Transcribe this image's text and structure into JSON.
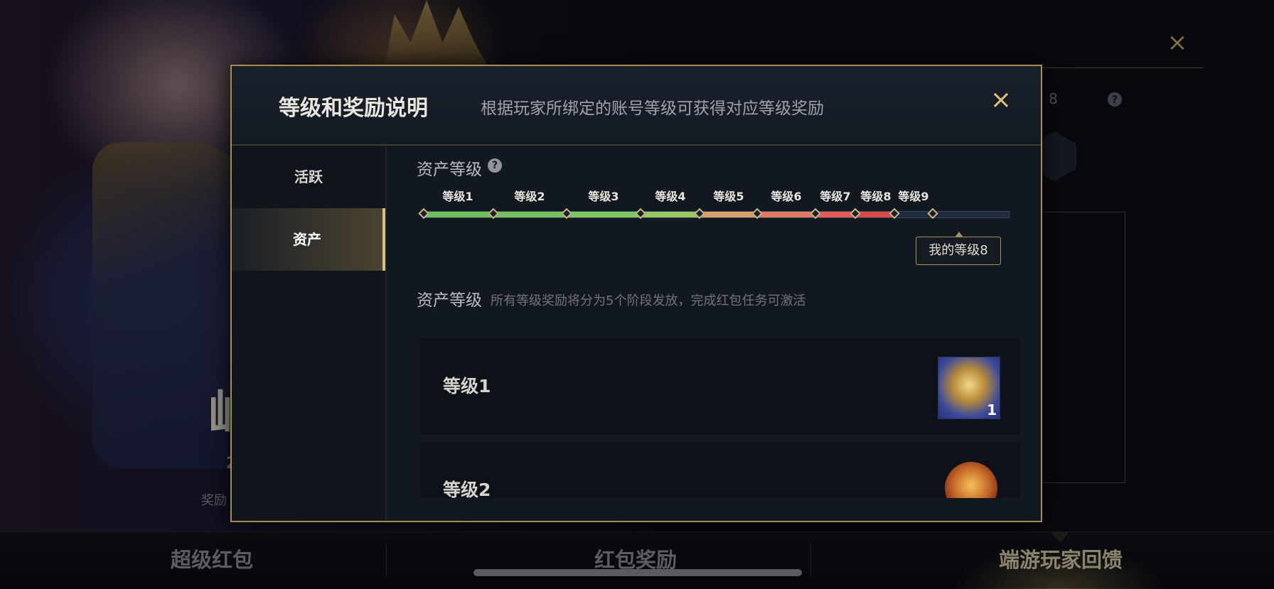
{
  "background": {
    "glyph": "屾",
    "small_text": "奖励",
    "small_two": "2",
    "level_text": ": 8",
    "help_icon": "?",
    "close_icon": "×"
  },
  "bottom_nav": {
    "tabs": [
      "超级红包",
      "红包奖励",
      "端游玩家回馈"
    ],
    "active_index": 2
  },
  "modal": {
    "title": "等级和奖励说明",
    "subtitle": "根据玩家所绑定的账号等级可获得对应等级奖励",
    "close_icon": "×",
    "sidebar": [
      "活跃",
      "资产"
    ],
    "active_sidebar_index": 1,
    "asset_level_title": "资产等级",
    "help_icon": "?",
    "track": {
      "labels": [
        "等级1",
        "等级2",
        "等级3",
        "等级4",
        "等级5",
        "等级6",
        "等级7",
        "等级8",
        "等级9"
      ],
      "segment_colors": [
        "#6fbf5a",
        "#73c25c",
        "#7ec75f",
        "#98c95f",
        "#d8a06a",
        "#e07a62",
        "#e05c54",
        "#d94a4a",
        "#1e2a3e"
      ],
      "node_count": 10,
      "current_level": 8
    },
    "my_level_tag": "我的等级8",
    "reward_section_title": "资产等级",
    "reward_note": "所有等级奖励将分为5个阶段发放，完成红包任务可激活",
    "rewards": [
      {
        "name": "等级1",
        "icon": "gold-emblem-icon",
        "count": "1"
      },
      {
        "name": "等级2",
        "icon": "golden-mask-icon",
        "count": ""
      }
    ]
  }
}
